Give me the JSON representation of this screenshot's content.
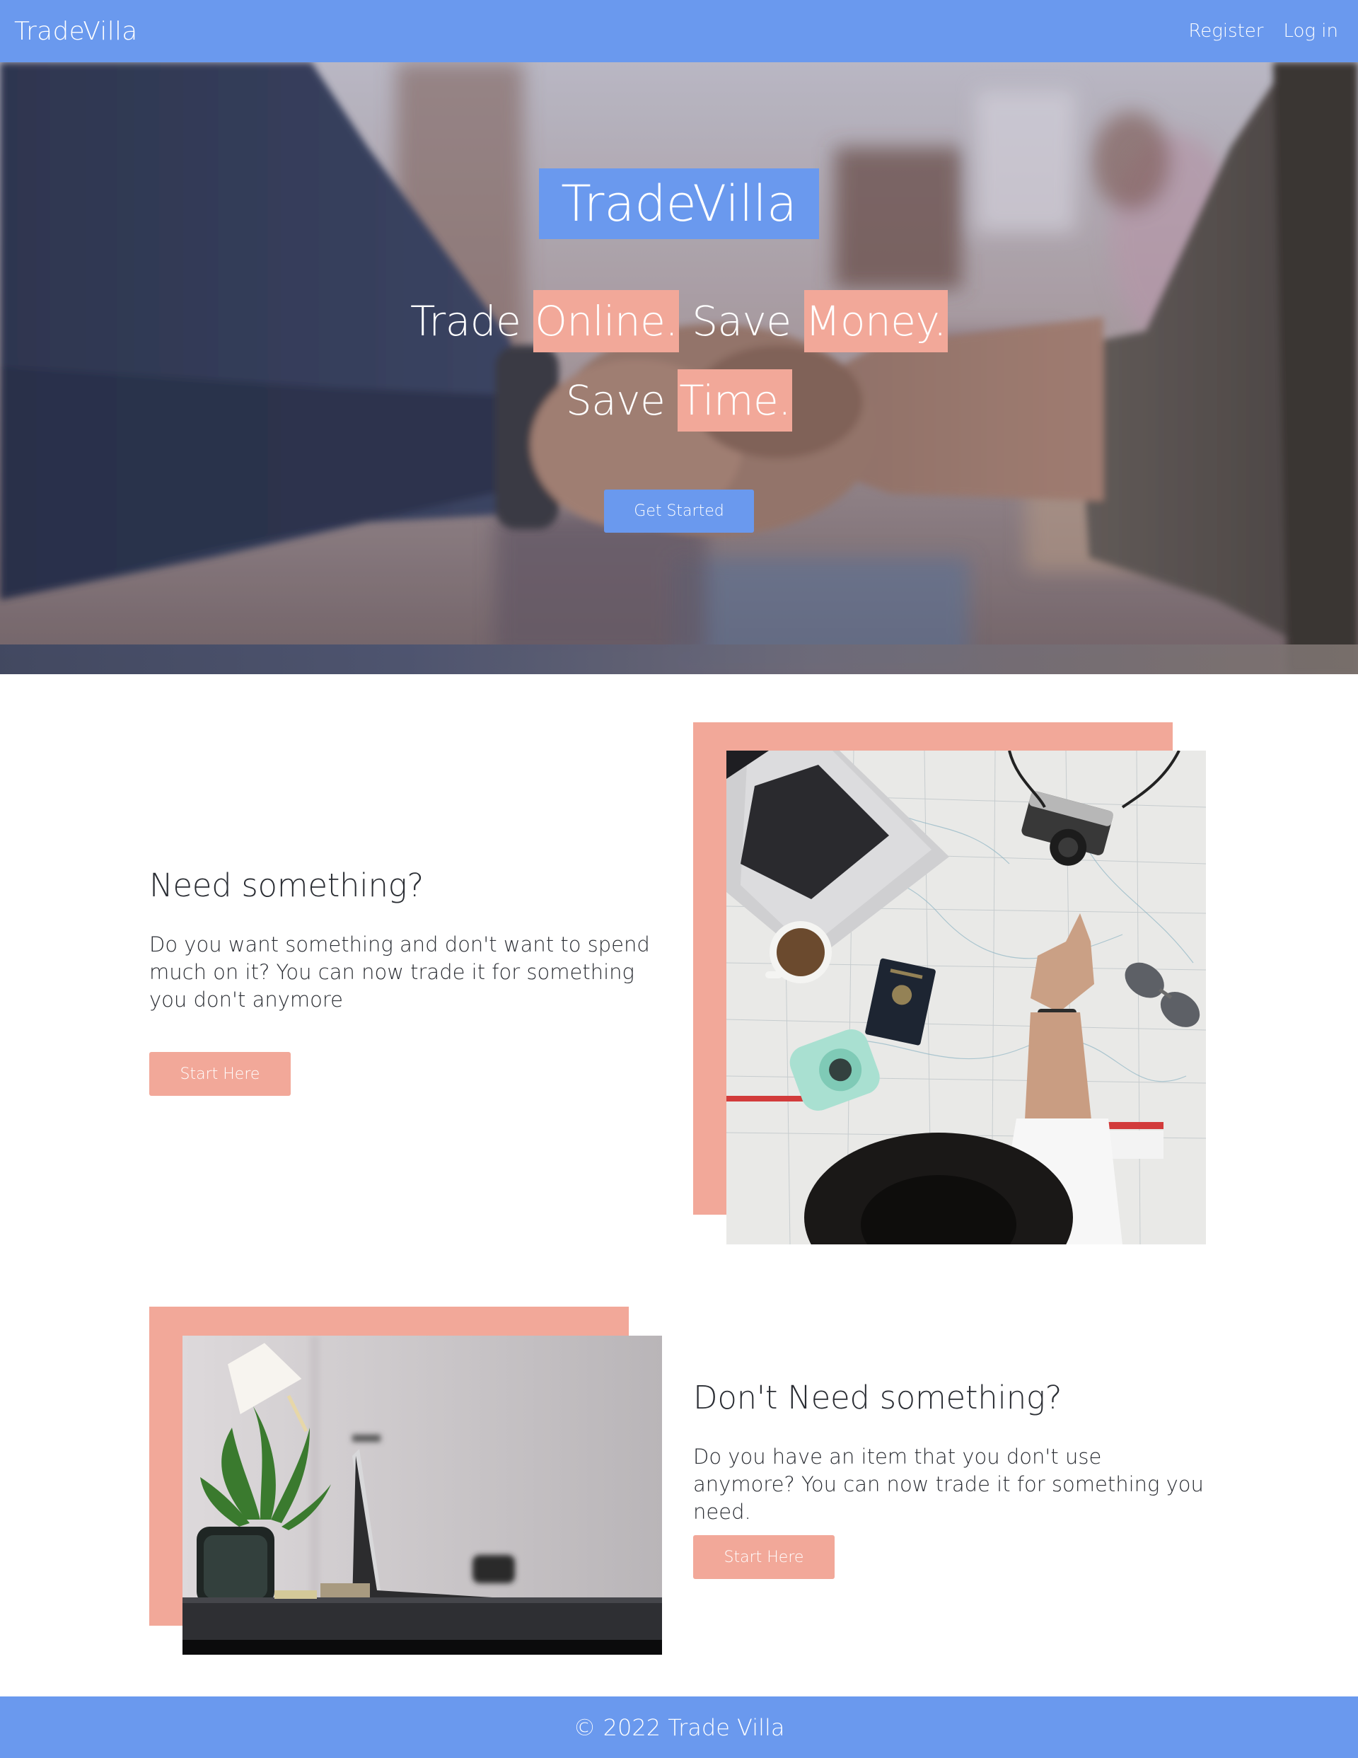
{
  "navbar": {
    "brand": "TradeVilla",
    "links": [
      "Register",
      "Log in"
    ]
  },
  "hero": {
    "title": "TradeVilla",
    "tagline_line1": {
      "part1": "Trade ",
      "highlight1": "Online.",
      "part2": " Save ",
      "highlight2": "Money."
    },
    "tagline_line2": {
      "part1": "Save ",
      "highlight1": "Time."
    },
    "cta_label": "Get Started"
  },
  "section_need": {
    "heading": "Need something?",
    "body": "Do you want something and don't want to spend much on it? You can now trade it for something you don't anymore",
    "button_label": "Start Here"
  },
  "section_dont_need": {
    "heading": "Don't Need something?",
    "body": "Do you have an item that you don't use anymore? You can now trade it for something you need.",
    "button_label": "Start Here"
  },
  "footer": {
    "text": "© 2022 Trade Villa"
  },
  "colors": {
    "primary_blue": "#6a99ee",
    "accent_salmon": "#f2a899",
    "text_dark": "#2a2d33"
  }
}
